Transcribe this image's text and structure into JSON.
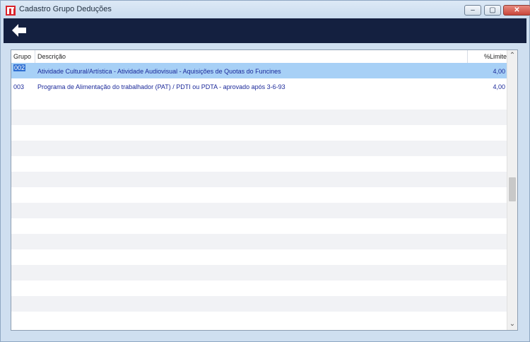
{
  "window": {
    "title": "Cadastro Grupo Deduções",
    "minimize_label": "‒",
    "maximize_label": "▢",
    "close_label": "✕"
  },
  "grid": {
    "columns": [
      {
        "key": "grupo",
        "label": "Grupo"
      },
      {
        "key": "descricao",
        "label": "Descrição"
      },
      {
        "key": "limite",
        "label": "%Limite"
      }
    ],
    "rows": [
      {
        "grupo": "002",
        "descricao": "Atividade Cultural/Artística - Atividade Audiovisual - Aquisições de Quotas do Funcines",
        "limite": "4,00",
        "selected": true
      },
      {
        "grupo": "003",
        "descricao": "Programa de Alimentação do trabalhador (PAT) / PDTI ou PDTA - aprovado após 3-6-93",
        "limite": "4,00",
        "selected": false
      }
    ],
    "scroll_up": "⌃",
    "scroll_down": "⌄"
  }
}
